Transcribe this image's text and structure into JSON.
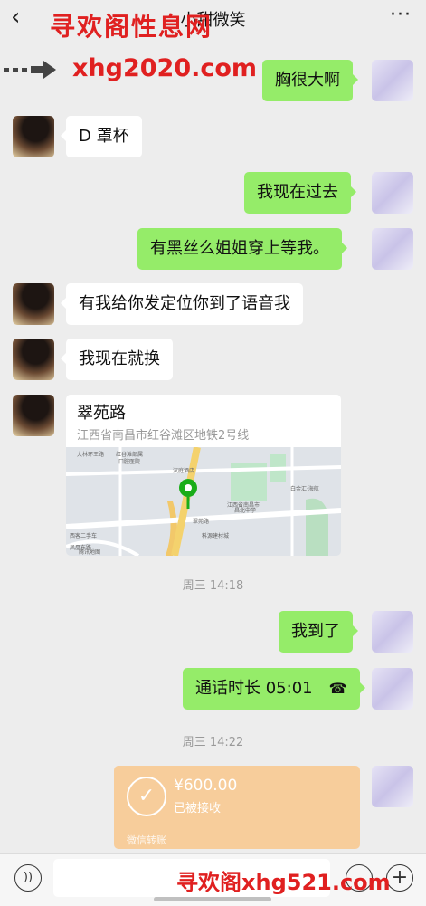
{
  "header": {
    "back_icon": "‹",
    "title": "小甜微笑",
    "more_icon": "···"
  },
  "watermarks": {
    "top": "寻欢阁性息网",
    "mid": "xhg2020.com",
    "bottom": "寻欢阁xhg521.com"
  },
  "messages": [
    {
      "side": "self",
      "kind": "text",
      "text": "胸很大啊"
    },
    {
      "side": "other",
      "kind": "text",
      "text": "D 罩杯"
    },
    {
      "side": "self",
      "kind": "text",
      "text": "我现在过去"
    },
    {
      "side": "self",
      "kind": "text",
      "text": "有黑丝么姐姐穿上等我。"
    },
    {
      "side": "other",
      "kind": "text",
      "text": "有我给你发定位你到了语音我"
    },
    {
      "side": "other",
      "kind": "text",
      "text": "我现在就换"
    }
  ],
  "location": {
    "name": "翠苑路",
    "address": "江西省南昌市红谷滩区地铁2号线",
    "map_labels": [
      "大林环王路",
      "红谷滩部属",
      "口腔医院",
      "汉庭酒店",
      "江西省南昌市",
      "昌北中学",
      "翠苑路",
      "科源建材城",
      "西客二手车",
      "凤凰东路",
      "腾讯地图",
      "白金汇·海航"
    ]
  },
  "timestamps": [
    "周三 14:18",
    "周三 14:22"
  ],
  "messages2": [
    {
      "side": "self",
      "kind": "text",
      "text": "我到了"
    },
    {
      "side": "self",
      "kind": "call",
      "text": "通话时长 05:01",
      "icon": "phone-hangup-icon"
    }
  ],
  "transfer": {
    "amount": "¥600.00",
    "status": "已被接收",
    "brand": "微信转账"
  },
  "bottom_bar": {
    "voice_icon": "voice-icon",
    "emoji_icon": "emoji-icon",
    "plus_icon": "plus-icon"
  }
}
